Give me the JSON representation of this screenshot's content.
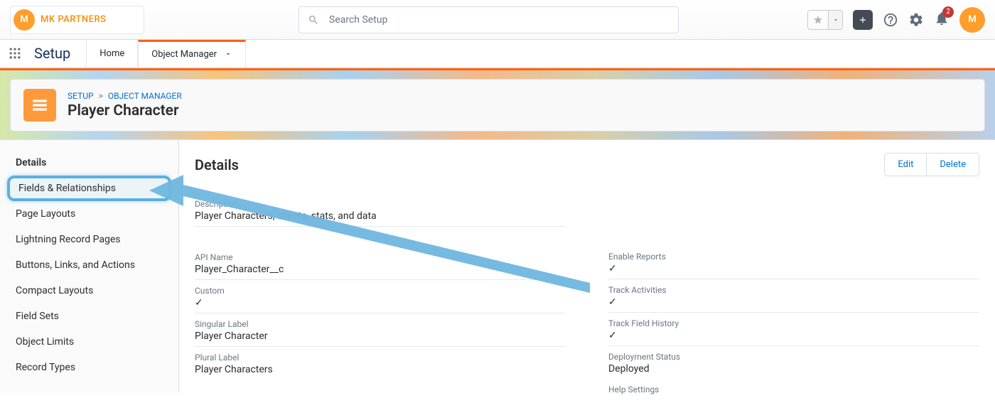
{
  "org": {
    "logo_letter": "M",
    "name": "MK PARTNERS"
  },
  "search": {
    "placeholder": "Search Setup"
  },
  "util": {
    "notification_count": "2",
    "avatar_letter": "M"
  },
  "nav": {
    "app_name": "Setup",
    "item_home": "Home",
    "item_object_manager": "Object Manager"
  },
  "breadcrumb": {
    "setup": "SETUP",
    "object_manager": "OBJECT MANAGER",
    "sep": ">"
  },
  "page_name": "Player Character",
  "sidebar": {
    "details": "Details",
    "fields": "Fields & Relationships",
    "page_layouts": "Page Layouts",
    "lightning": "Lightning Record Pages",
    "buttons": "Buttons, Links, and Actions",
    "compact": "Compact Layouts",
    "field_sets": "Field Sets",
    "object_limits": "Object Limits",
    "record_types": "Record Types"
  },
  "main": {
    "title": "Details",
    "edit": "Edit",
    "delete": "Delete",
    "left": {
      "description_label": "Description",
      "description_value": "Player Characters, sheets, stats, and data",
      "api_label": "API Name",
      "api_value": "Player_Character__c",
      "custom_label": "Custom",
      "singular_label": "Singular Label",
      "singular_value": "Player Character",
      "plural_label": "Plural Label",
      "plural_value": "Player Characters"
    },
    "right": {
      "enable_reports": "Enable Reports",
      "track_activities": "Track Activities",
      "track_history": "Track Field History",
      "deployment_label": "Deployment Status",
      "deployment_value": "Deployed",
      "help_settings": "Help Settings"
    }
  }
}
